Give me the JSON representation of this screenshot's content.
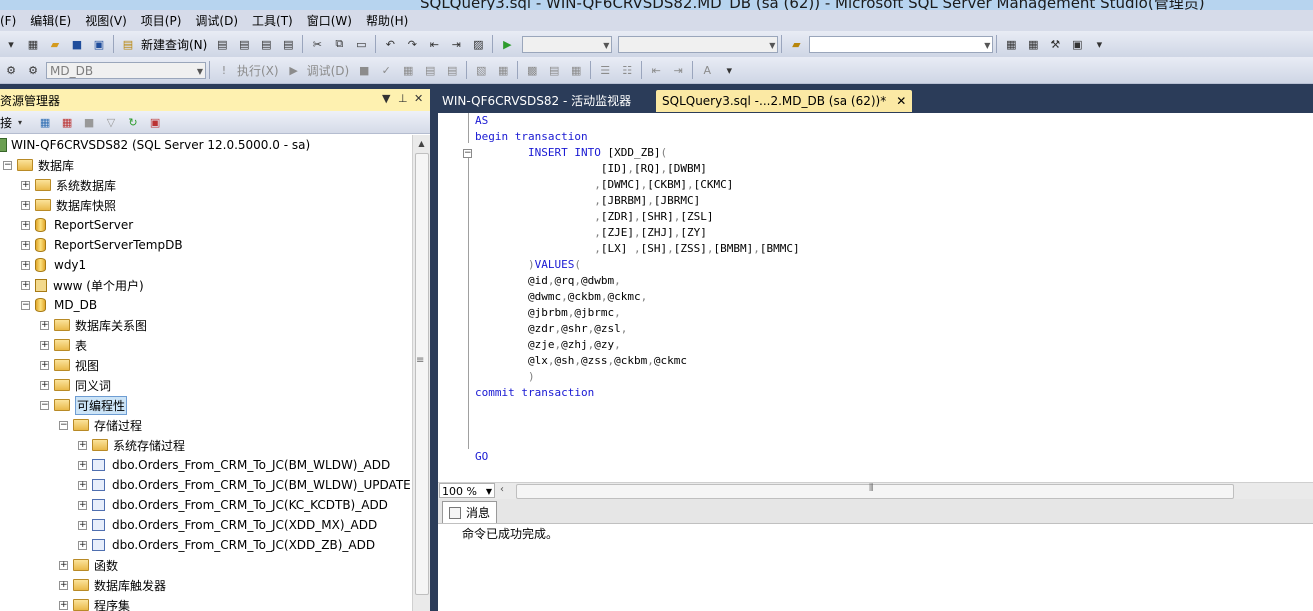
{
  "window": {
    "title": "SQLQuery3.sql - WIN-QF6CRVSDS82.MD_DB (sa (62)) - Microsoft SQL Server Management Studio(管理员)"
  },
  "menu": [
    "(F)",
    "编辑(E)",
    "视图(V)",
    "项目(P)",
    "调试(D)",
    "工具(T)",
    "窗口(W)",
    "帮助(H)"
  ],
  "toolbar1": {
    "new_query_label": "新建查询(N)"
  },
  "toolbar2": {
    "database_combo": "MD_DB",
    "execute_label": "执行(X)",
    "debug_label": "调试(D)"
  },
  "object_explorer": {
    "title": "资源管理器",
    "connect_label": "接",
    "tree": [
      {
        "label": "WIN-QF6CRVSDS82 (SQL Server 12.0.5000.0 - sa)",
        "icon": "server-icon",
        "depth": 0,
        "expander": "-"
      },
      {
        "label": "数据库",
        "icon": "folder-icon",
        "depth": 0,
        "expander": "-"
      },
      {
        "label": "系统数据库",
        "icon": "folder-icon",
        "depth": 1,
        "expander": "+"
      },
      {
        "label": "数据库快照",
        "icon": "folder-icon",
        "depth": 1,
        "expander": "+"
      },
      {
        "label": "ReportServer",
        "icon": "database-icon",
        "depth": 1,
        "expander": "+"
      },
      {
        "label": "ReportServerTempDB",
        "icon": "database-icon",
        "depth": 1,
        "expander": "+"
      },
      {
        "label": "wdy1",
        "icon": "database-icon",
        "depth": 1,
        "expander": "+"
      },
      {
        "label": "www (单个用户)",
        "icon": "user-db-icon",
        "depth": 1,
        "expander": "+"
      },
      {
        "label": "MD_DB",
        "icon": "database-icon",
        "depth": 1,
        "expander": "-"
      },
      {
        "label": "数据库关系图",
        "icon": "folder-icon",
        "depth": 2,
        "expander": "+"
      },
      {
        "label": "表",
        "icon": "folder-icon",
        "depth": 2,
        "expander": "+"
      },
      {
        "label": "视图",
        "icon": "folder-icon",
        "depth": 2,
        "expander": "+"
      },
      {
        "label": "同义词",
        "icon": "folder-icon",
        "depth": 2,
        "expander": "+"
      },
      {
        "label": "可编程性",
        "icon": "folder-icon",
        "depth": 2,
        "expander": "-",
        "selected": true
      },
      {
        "label": "存储过程",
        "icon": "folder-icon",
        "depth": 3,
        "expander": "-"
      },
      {
        "label": "系统存储过程",
        "icon": "folder-icon",
        "depth": 4,
        "expander": "+"
      },
      {
        "label": "dbo.Orders_From_CRM_To_JC(BM_WLDW)_ADD",
        "icon": "procedure-icon",
        "depth": 4,
        "expander": "+"
      },
      {
        "label": "dbo.Orders_From_CRM_To_JC(BM_WLDW)_UPDATE",
        "icon": "procedure-icon",
        "depth": 4,
        "expander": "+"
      },
      {
        "label": "dbo.Orders_From_CRM_To_JC(KC_KCDTB)_ADD",
        "icon": "procedure-icon",
        "depth": 4,
        "expander": "+"
      },
      {
        "label": "dbo.Orders_From_CRM_To_JC(XDD_MX)_ADD",
        "icon": "procedure-icon",
        "depth": 4,
        "expander": "+"
      },
      {
        "label": "dbo.Orders_From_CRM_To_JC(XDD_ZB)_ADD",
        "icon": "procedure-icon",
        "depth": 4,
        "expander": "+"
      },
      {
        "label": "函数",
        "icon": "folder-icon",
        "depth": 3,
        "expander": "+"
      },
      {
        "label": "数据库触发器",
        "icon": "folder-icon",
        "depth": 3,
        "expander": "+"
      },
      {
        "label": "程序集",
        "icon": "folder-icon",
        "depth": 3,
        "expander": "+"
      }
    ]
  },
  "tabs": [
    {
      "label": "WIN-QF6CRVSDS82 - 活动监视器",
      "active": false
    },
    {
      "label": "SQLQuery3.sql -...2.MD_DB (sa (62))*",
      "active": true
    }
  ],
  "editor": {
    "lines": [
      "AS",
      "begin transaction",
      "        INSERT INTO [XDD_ZB](",
      "                   [ID],[RQ],[DWBM]",
      "                  ,[DWMC],[CKBM],[CKMC]",
      "                  ,[JBRBM],[JBRMC]",
      "                  ,[ZDR],[SHR],[ZSL]",
      "                  ,[ZJE],[ZHJ],[ZY]",
      "                  ,[LX] ,[SH],[ZSS],[BMBM],[BMMC]",
      "        )VALUES(",
      "        @id,@rq,@dwbm,",
      "        @dwmc,@ckbm,@ckmc,",
      "        @jbrbm,@jbrmc,",
      "        @zdr,@shr,@zsl,",
      "        @zje,@zhj,@zy,",
      "        @lx,@sh,@zss,@ckbm,@ckmc",
      "        )",
      "commit transaction",
      "",
      "",
      "",
      "GO"
    ],
    "zoom": "100 %"
  },
  "results": {
    "tab_label": "消息",
    "message": "命令已成功完成。"
  }
}
